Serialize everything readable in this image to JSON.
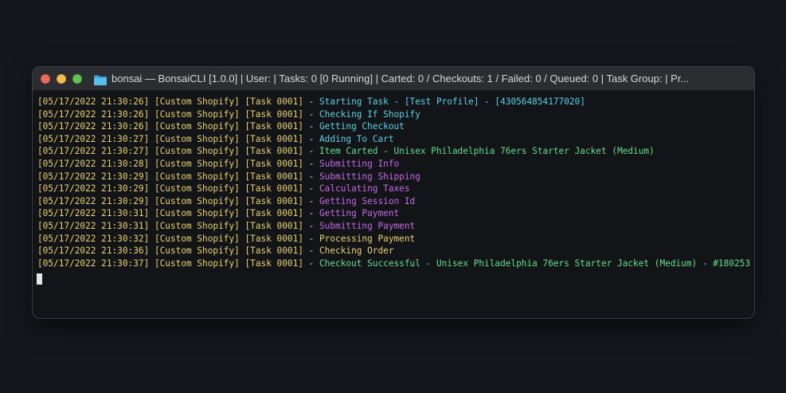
{
  "window": {
    "title": "bonsai — BonsaiCLI [1.0.0] | User:  | Tasks: 0 [0 Running] | Carted: 0 / Checkouts: 1 / Failed: 0 / Queued: 0 | Task Group:  | Pr...",
    "folder_icon": "folder-icon",
    "traffic_lights": [
      "close",
      "minimize",
      "maximize"
    ]
  },
  "colors": {
    "prefix": "#e9d26a",
    "cyan": "#56d3e6",
    "purple": "#c56ae8",
    "green": "#5fe08d",
    "yellow": "#e9d26a"
  },
  "terminal": {
    "lines": [
      {
        "prefix": "[05/17/2022 21:30:26] [Custom Shopify] [Task 0001]",
        "dash": " - ",
        "message": "Starting Task - [Test Profile] - [430564854177020]",
        "color": "cyan"
      },
      {
        "prefix": "[05/17/2022 21:30:26] [Custom Shopify] [Task 0001]",
        "dash": " - ",
        "message": "Checking If Shopify",
        "color": "cyan"
      },
      {
        "prefix": "[05/17/2022 21:30:26] [Custom Shopify] [Task 0001]",
        "dash": " - ",
        "message": "Getting Checkout",
        "color": "cyan"
      },
      {
        "prefix": "[05/17/2022 21:30:27] [Custom Shopify] [Task 0001]",
        "dash": " - ",
        "message": "Adding To Cart",
        "color": "cyan"
      },
      {
        "prefix": "[05/17/2022 21:30:27] [Custom Shopify] [Task 0001]",
        "dash": " - ",
        "message": "Item Carted - Unisex Philadelphia 76ers Starter Jacket (Medium)",
        "color": "green"
      },
      {
        "prefix": "[05/17/2022 21:30:28] [Custom Shopify] [Task 0001]",
        "dash": " - ",
        "message": "Submitting Info",
        "color": "purple"
      },
      {
        "prefix": "[05/17/2022 21:30:29] [Custom Shopify] [Task 0001]",
        "dash": " - ",
        "message": "Submitting Shipping",
        "color": "purple"
      },
      {
        "prefix": "[05/17/2022 21:30:29] [Custom Shopify] [Task 0001]",
        "dash": " - ",
        "message": "Calculating Taxes",
        "color": "purple"
      },
      {
        "prefix": "[05/17/2022 21:30:29] [Custom Shopify] [Task 0001]",
        "dash": " - ",
        "message": "Getting Session Id",
        "color": "purple"
      },
      {
        "prefix": "[05/17/2022 21:30:31] [Custom Shopify] [Task 0001]",
        "dash": " - ",
        "message": "Getting Payment",
        "color": "purple"
      },
      {
        "prefix": "[05/17/2022 21:30:31] [Custom Shopify] [Task 0001]",
        "dash": " - ",
        "message": "Submitting Payment",
        "color": "purple"
      },
      {
        "prefix": "[05/17/2022 21:30:32] [Custom Shopify] [Task 0001]",
        "dash": " - ",
        "message": "Processing Payment",
        "color": "yellow"
      },
      {
        "prefix": "[05/17/2022 21:30:36] [Custom Shopify] [Task 0001]",
        "dash": " - ",
        "message": "Checking Order",
        "color": "yellow"
      },
      {
        "prefix": "[05/17/2022 21:30:37] [Custom Shopify] [Task 0001]",
        "dash": " - ",
        "message": "Checkout Successful - Unisex Philadelphia 76ers Starter Jacket (Medium) - #180253",
        "color": "green"
      }
    ]
  }
}
